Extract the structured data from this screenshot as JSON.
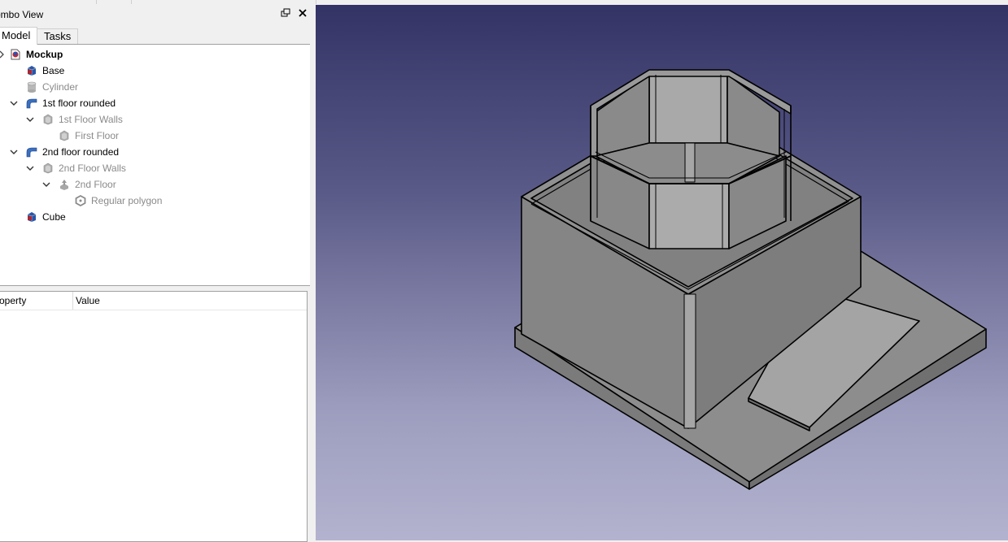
{
  "combo_view": {
    "title": "ombo View",
    "float_icon": "float-icon",
    "close_icon": "close-icon",
    "tabs": [
      {
        "label": "Model",
        "active": true
      },
      {
        "label": "Tasks",
        "active": false
      }
    ]
  },
  "tree": {
    "items": [
      {
        "label": "Mockup",
        "icon": "document-icon",
        "style": "bold"
      },
      {
        "label": "Base",
        "icon": "cube-icon",
        "style": "normal"
      },
      {
        "label": "Cylinder",
        "icon": "cylinder-icon",
        "style": "dim"
      },
      {
        "label": "1st floor rounded",
        "icon": "fillet-icon",
        "style": "normal",
        "expanded": true
      },
      {
        "label": "1st Floor Walls",
        "icon": "wall-icon",
        "style": "dim",
        "expanded": true
      },
      {
        "label": "First Floor",
        "icon": "wall-icon",
        "style": "dim"
      },
      {
        "label": "2nd floor rounded",
        "icon": "fillet-icon",
        "style": "normal",
        "expanded": true
      },
      {
        "label": "2nd Floor Walls",
        "icon": "wall-icon",
        "style": "dim",
        "expanded": true
      },
      {
        "label": "2nd Floor",
        "icon": "extrude-icon",
        "style": "dim",
        "expanded": true
      },
      {
        "label": "Regular polygon",
        "icon": "polygon-icon",
        "style": "dim"
      },
      {
        "label": "Cube",
        "icon": "cube-icon",
        "style": "normal"
      }
    ]
  },
  "property_view": {
    "headers": [
      "roperty",
      "Value"
    ]
  },
  "viewport": {
    "background_top": "#333366",
    "background_bottom": "#b3b3cf",
    "model_color": "#8c8c8c"
  }
}
